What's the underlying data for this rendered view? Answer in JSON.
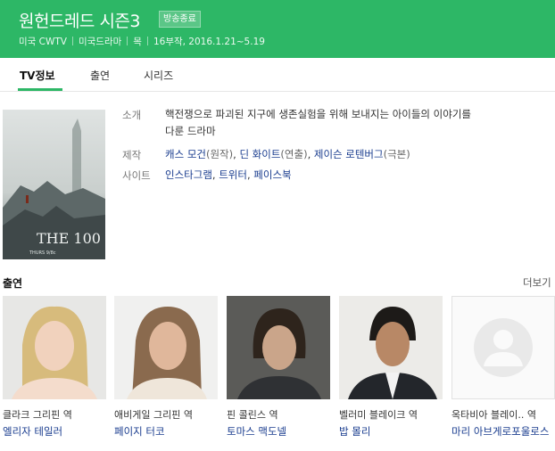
{
  "header": {
    "title": "원헌드레드 시즌3",
    "badge": "방송종료",
    "meta": [
      "미국 CWTV",
      "미국드라마",
      "목",
      "16부작, 2016.1.21~5.19"
    ]
  },
  "tabs": [
    {
      "label": "TV정보",
      "active": true
    },
    {
      "label": "출연",
      "active": false
    },
    {
      "label": "시리즈",
      "active": false
    }
  ],
  "poster": {
    "logo_text": "THE 100",
    "caption": "THURS 9/8c"
  },
  "info": {
    "intro_label": "소개",
    "intro_line1": "핵전쟁으로 파괴된 지구에 생존실험을 위해 보내지는 아이들의 이야기를",
    "intro_line2": "다룬 드라마",
    "prod_label": "제작",
    "prod": [
      {
        "name": "캐스 모건",
        "role": "(원작)"
      },
      {
        "name": "딘 화이트",
        "role": "(연출)"
      },
      {
        "name": "제이슨 로텐버그",
        "role": "(극본)"
      }
    ],
    "site_label": "사이트",
    "sites": [
      "인스타그램",
      "트위터",
      "페이스북"
    ]
  },
  "cast": {
    "heading": "출연",
    "more_label": "더보기",
    "members": [
      {
        "role": "클라크 그리핀 역",
        "actor": "엘리자 테일러"
      },
      {
        "role": "애비게일 그리핀 역",
        "actor": "페이지 터코"
      },
      {
        "role": "핀 콜린스 역",
        "actor": "토마스 맥도넬"
      },
      {
        "role": "벨러미 블레이크 역",
        "actor": "밥 몰리"
      },
      {
        "role": "옥타비아 블레이.. 역",
        "actor": "마리 아브게로포울로스"
      }
    ]
  },
  "colors": {
    "brand": "#2db766",
    "link": "#1a3d8f"
  }
}
